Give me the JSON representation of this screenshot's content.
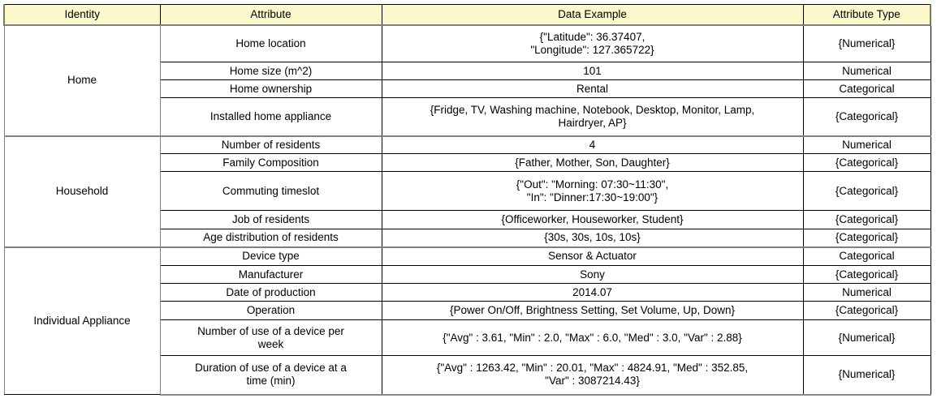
{
  "table": {
    "headers": [
      "Identity",
      "Attribute",
      "Data Example",
      "Attribute Type"
    ],
    "groups": [
      {
        "identity": "Home",
        "rows": [
          {
            "attribute": "Home location",
            "example": "{\"Latitude\": 36.37407,\n\"Longitude\": 127.365722}",
            "type": "{Numerical}"
          },
          {
            "attribute": "Home size (m^2)",
            "example": "101",
            "type": "Numerical"
          },
          {
            "attribute": "Home ownership",
            "example": "Rental",
            "type": "Categorical"
          },
          {
            "attribute": "Installed home appliance",
            "example": "{Fridge, TV, Washing machine, Notebook, Desktop, Monitor, Lamp,\nHairdryer, AP}",
            "type": "{Categorical}"
          }
        ]
      },
      {
        "identity": "Household",
        "rows": [
          {
            "attribute": "Number of residents",
            "example": "4",
            "type": "Numerical"
          },
          {
            "attribute": "Family Composition",
            "example": "{Father, Mother, Son, Daughter}",
            "type": "{Categorical}"
          },
          {
            "attribute": "Commuting timeslot",
            "example": "{\"Out\": \"Morning: 07:30~11:30\",\n\"In\": \"Dinner:17:30~19:00\"}",
            "type": "{Categorical}"
          },
          {
            "attribute": "Job of residents",
            "example": "{Officeworker, Houseworker, Student}",
            "type": "{Categorical}"
          },
          {
            "attribute": "Age distribution of residents",
            "example": "{30s, 30s, 10s, 10s}",
            "type": "{Categorical}"
          }
        ]
      },
      {
        "identity": "Individual Appliance",
        "rows": [
          {
            "attribute": "Device type",
            "example": "Sensor & Actuator",
            "type": "Categorical"
          },
          {
            "attribute": "Manufacturer",
            "example": "Sony",
            "type": "{Categorical}"
          },
          {
            "attribute": "Date of production",
            "example": "2014.07",
            "type": "Numerical"
          },
          {
            "attribute": "Operation",
            "example": "{Power On/Off, Brightness Setting, Set Volume, Up, Down}",
            "type": "{Categorical}"
          },
          {
            "attribute": "Number of use of a device per\nweek",
            "example": "{\"Avg\" : 3.61, \"Min\" : 2.0, \"Max\" : 6.0, \"Med\" : 3.0, \"Var\" : 2.88}",
            "type": "{Numerical}"
          },
          {
            "attribute": "Duration of use of a device at a\ntime (min)",
            "example": "{\"Avg\" : 1263.42, \"Min\" : 20.01, \"Max\" : 4824.91, \"Med\" : 352.85,\n\"Var\" : 3087214.43}",
            "type": "{Numerical}"
          }
        ]
      }
    ],
    "row_heights": {
      "header": 25,
      "rows": [
        46,
        22,
        22,
        47,
        22,
        22,
        48,
        23,
        22,
        23,
        22,
        22,
        23,
        44,
        48
      ]
    },
    "colors": {
      "header_fill": "#FBF8CC",
      "border": "#000000",
      "text": "#000000",
      "background": "#FFFFFF"
    }
  }
}
